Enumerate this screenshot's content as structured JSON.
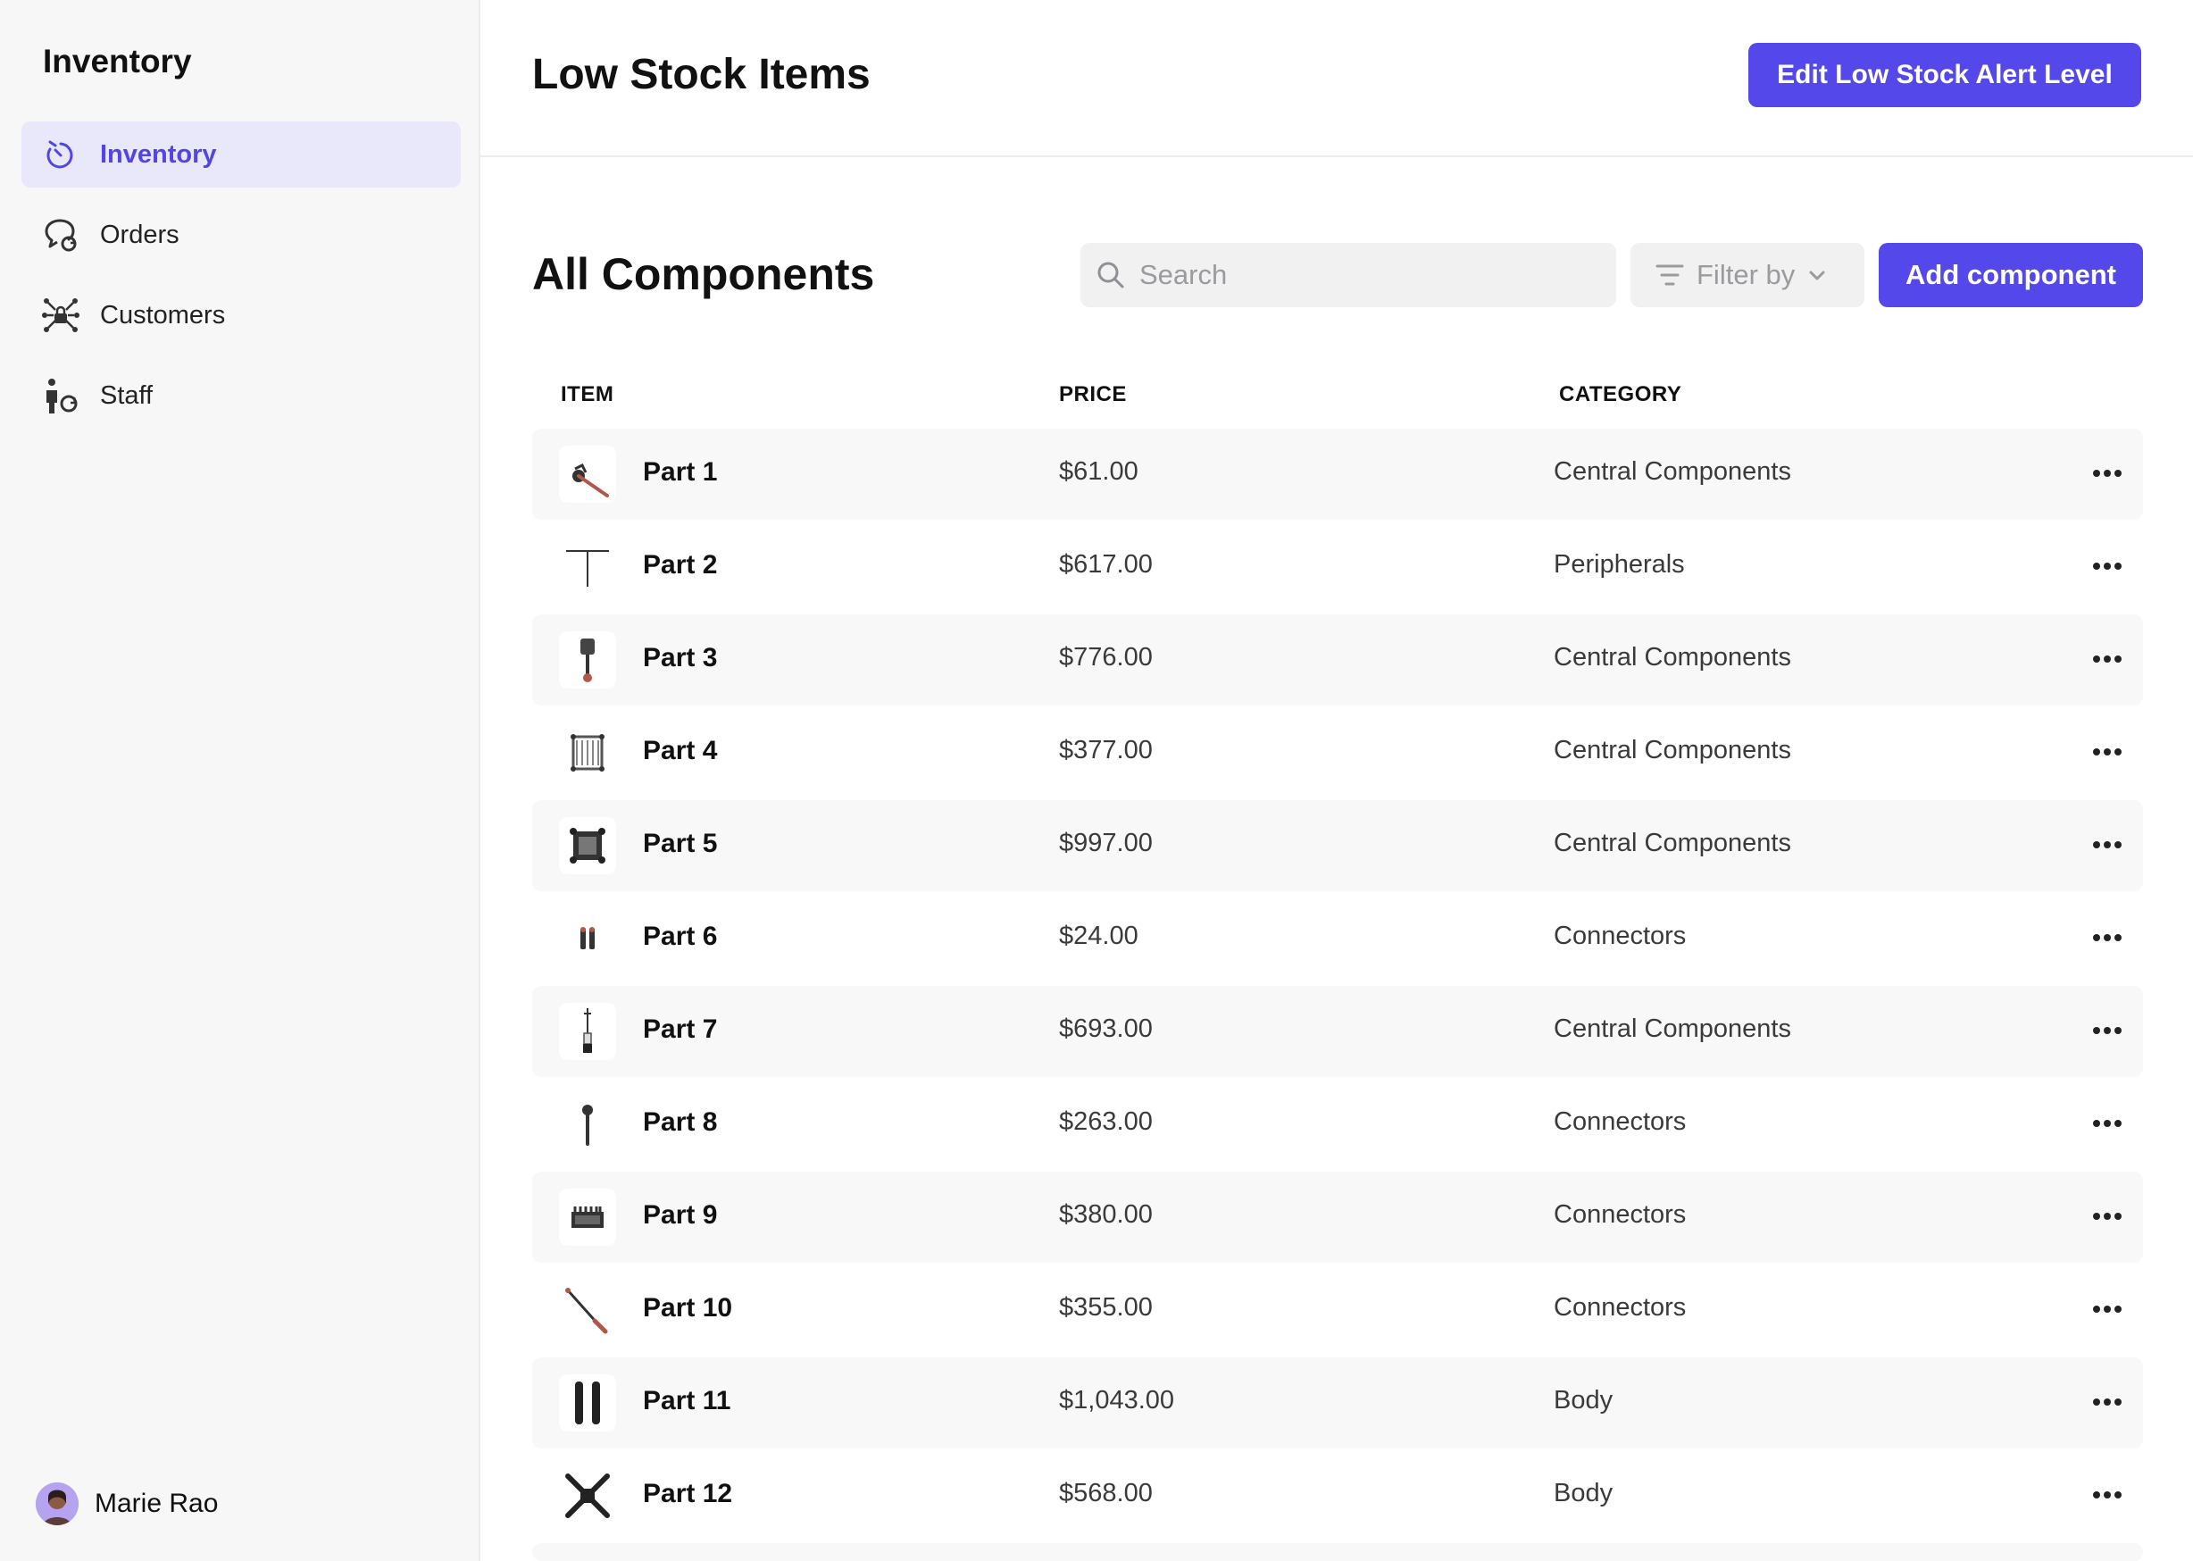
{
  "sidebar": {
    "title": "Inventory",
    "items": [
      {
        "label": "Inventory",
        "icon": "stopwatch-icon",
        "active": true
      },
      {
        "label": "Orders",
        "icon": "chat-refresh-icon",
        "active": false
      },
      {
        "label": "Customers",
        "icon": "network-lock-icon",
        "active": false
      },
      {
        "label": "Staff",
        "icon": "person-refresh-icon",
        "active": false
      }
    ],
    "user": {
      "name": "Marie Rao"
    }
  },
  "header": {
    "title": "Low Stock Items",
    "edit_button_label": "Edit Low Stock Alert Level"
  },
  "components": {
    "title": "All Components",
    "search_placeholder": "Search",
    "filter_label": "Filter by",
    "add_button_label": "Add component",
    "columns": [
      "ITEM",
      "PRICE",
      "CATEGORY"
    ],
    "rows": [
      {
        "name": "Part 1",
        "price": "$61.00",
        "category": "Central Components"
      },
      {
        "name": "Part 2",
        "price": "$617.00",
        "category": "Peripherals"
      },
      {
        "name": "Part 3",
        "price": "$776.00",
        "category": "Central Components"
      },
      {
        "name": "Part 4",
        "price": "$377.00",
        "category": "Central Components"
      },
      {
        "name": "Part 5",
        "price": "$997.00",
        "category": "Central Components"
      },
      {
        "name": "Part 6",
        "price": "$24.00",
        "category": "Connectors"
      },
      {
        "name": "Part 7",
        "price": "$693.00",
        "category": "Central Components"
      },
      {
        "name": "Part 8",
        "price": "$263.00",
        "category": "Connectors"
      },
      {
        "name": "Part 9",
        "price": "$380.00",
        "category": "Connectors"
      },
      {
        "name": "Part 10",
        "price": "$355.00",
        "category": "Connectors"
      },
      {
        "name": "Part 11",
        "price": "$1,043.00",
        "category": "Body"
      },
      {
        "name": "Part 12",
        "price": "$568.00",
        "category": "Body"
      }
    ]
  },
  "colors": {
    "accent": "#5448ea",
    "active_nav_bg": "#e9e8fb",
    "sidebar_bg": "#f7f7f8"
  }
}
